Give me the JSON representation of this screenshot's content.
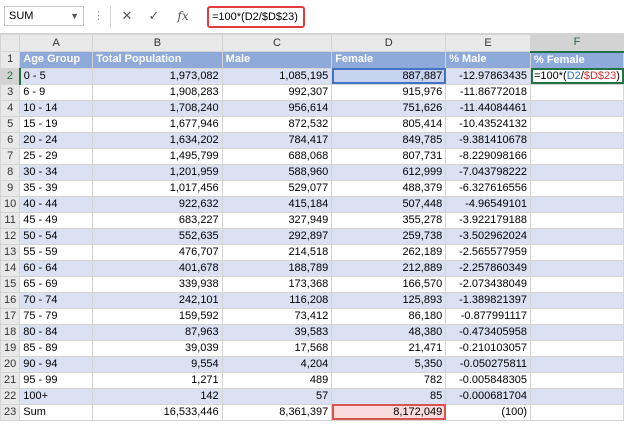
{
  "formula_bar": {
    "name_box": "SUM",
    "formula": "=100*(D2/$D$23)",
    "buttons": [
      "✕",
      "✓",
      "fx"
    ]
  },
  "columns": [
    "A",
    "B",
    "C",
    "D",
    "E",
    "F"
  ],
  "header_row": {
    "row_number": "1",
    "cells": [
      "Age Group",
      "Total Population",
      "Male",
      "Female",
      "% Male",
      "% Female"
    ]
  },
  "rows": [
    {
      "n": "2",
      "cells": [
        "0 - 5",
        "1,973,082",
        "1,085,195",
        "887,887",
        "-12.97863435",
        ""
      ]
    },
    {
      "n": "3",
      "cells": [
        "6 - 9",
        "1,908,283",
        "992,307",
        "915,976",
        "-11.86772018",
        ""
      ]
    },
    {
      "n": "4",
      "cells": [
        "10 - 14",
        "1,708,240",
        "956,614",
        "751,626",
        "-11.44084461",
        ""
      ]
    },
    {
      "n": "5",
      "cells": [
        "15 - 19",
        "1,677,946",
        "872,532",
        "805,414",
        "-10.43524132",
        ""
      ]
    },
    {
      "n": "6",
      "cells": [
        "20 - 24",
        "1,634,202",
        "784,417",
        "849,785",
        "-9.381410678",
        ""
      ]
    },
    {
      "n": "7",
      "cells": [
        "25 - 29",
        "1,495,799",
        "688,068",
        "807,731",
        "-8.229098166",
        ""
      ]
    },
    {
      "n": "8",
      "cells": [
        "30 - 34",
        "1,201,959",
        "588,960",
        "612,999",
        "-7.043798222",
        ""
      ]
    },
    {
      "n": "9",
      "cells": [
        "35 - 39",
        "1,017,456",
        "529,077",
        "488,379",
        "-6.327616556",
        ""
      ]
    },
    {
      "n": "10",
      "cells": [
        "40 - 44",
        "922,632",
        "415,184",
        "507,448",
        "-4.96549101",
        ""
      ]
    },
    {
      "n": "11",
      "cells": [
        "45 - 49",
        "683,227",
        "327,949",
        "355,278",
        "-3.922179188",
        ""
      ]
    },
    {
      "n": "12",
      "cells": [
        "50 - 54",
        "552,635",
        "292,897",
        "259,738",
        "-3.502962024",
        ""
      ]
    },
    {
      "n": "13",
      "cells": [
        "55 - 59",
        "476,707",
        "214,518",
        "262,189",
        "-2.565577959",
        ""
      ]
    },
    {
      "n": "14",
      "cells": [
        "60 - 64",
        "401,678",
        "188,789",
        "212,889",
        "-2.257860349",
        ""
      ]
    },
    {
      "n": "15",
      "cells": [
        "65 - 69",
        "339,938",
        "173,368",
        "166,570",
        "-2.073438049",
        ""
      ]
    },
    {
      "n": "16",
      "cells": [
        "70 - 74",
        "242,101",
        "116,208",
        "125,893",
        "-1.389821397",
        ""
      ]
    },
    {
      "n": "17",
      "cells": [
        "75 - 79",
        "159,592",
        "73,412",
        "86,180",
        "-0.877991117",
        ""
      ]
    },
    {
      "n": "18",
      "cells": [
        "80 - 84",
        "87,963",
        "39,583",
        "48,380",
        "-0.473405958",
        ""
      ]
    },
    {
      "n": "19",
      "cells": [
        "85 - 89",
        "39,039",
        "17,568",
        "21,471",
        "-0.210103057",
        ""
      ]
    },
    {
      "n": "20",
      "cells": [
        "90 - 94",
        "9,554",
        "4,204",
        "5,350",
        "-0.050275811",
        ""
      ]
    },
    {
      "n": "21",
      "cells": [
        "95 - 99",
        "1,271",
        "489",
        "782",
        "-0.005848305",
        ""
      ]
    },
    {
      "n": "22",
      "cells": [
        "100+",
        "142",
        "57",
        "85",
        "-0.000681704",
        ""
      ]
    },
    {
      "n": "23",
      "cells": [
        "Sum",
        "16,533,446",
        "8,361,397",
        "8,172,049",
        "(100)",
        ""
      ]
    }
  ],
  "active_cell_formula": {
    "prefix": "=100*(",
    "ref1": "D2",
    "slash": "/",
    "ref2": "$D$23",
    "suffix": ")"
  },
  "colors": {
    "header_fill": "#8eaadb",
    "band_fill": "#d9e1f2",
    "ref1_color": "#2f6fd0",
    "ref2_color": "#d02f2f",
    "highlight_red": "#e23b3b"
  }
}
